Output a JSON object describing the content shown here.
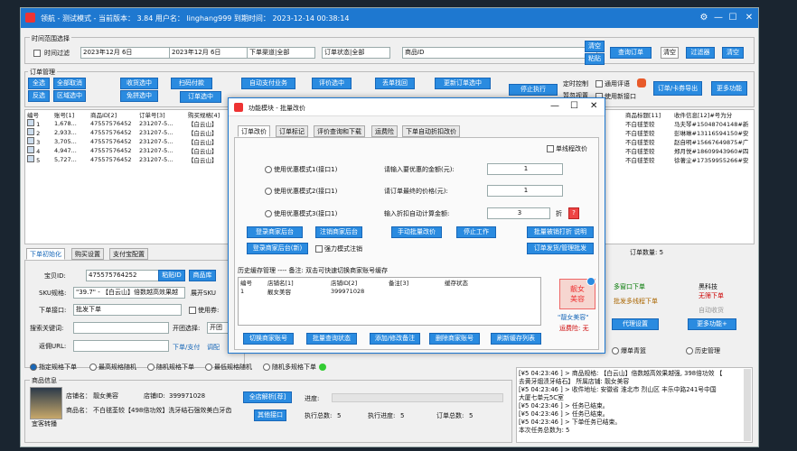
{
  "window": {
    "title": "领航 - 测试模式 - 当前版本： 3.84   用户名： linghang999   到期时间： 2023-12-14 00:38:14"
  },
  "time_range": {
    "legend": "时间范围选择",
    "filter_label": "时间过滤",
    "date_from": "2023年12月 6日",
    "date_to": "2023年12月 6日",
    "channel": "下单渠道|全部",
    "status": "订单状态|全部",
    "product_id": "商品ID",
    "clear": "清空",
    "paste": "粘贴",
    "query": "查询订单",
    "clear2": "清空",
    "filter": "过滤器"
  },
  "order_mgmt": {
    "legend": "订单管理",
    "select_all": "全选",
    "cancel_all": "全部取消",
    "invert": "反选",
    "range_select": "区域选中",
    "receive": "收货选中",
    "free_receive": "免拼选中",
    "scan_pay": "扫码付款",
    "order_select": "订单选中",
    "auto_pay": "自动支付业务",
    "other_pay": "其他支付业务",
    "evaluate": "评价选中",
    "reject": "退货选中",
    "delete_recover": "丢单找回",
    "push_reject": "推荐单退",
    "update_order": "更新订单选中",
    "update_status": "更新状态(全部)",
    "stop": "停止执行",
    "timer": "定时控制",
    "general_eval": "通用评语",
    "ignore_eval": "暂忽视置",
    "new_api": "使用新接口",
    "export": "订单/卡券导出",
    "more": "更多功能"
  },
  "table": {
    "headers": [
      "编号",
      "账号[1]",
      "商品ID[2]",
      "订单号[3]",
      "购买规格[4]"
    ],
    "rows": [
      [
        "1",
        "1,678...",
        "47557576452",
        "231207-5...",
        "【白云山】"
      ],
      [
        "2",
        "2,933...",
        "47557576452",
        "231207-5...",
        "【白云山】"
      ],
      [
        "3",
        "3,705...",
        "47557576452",
        "231207-5...",
        "【白云山】"
      ],
      [
        "4",
        "4,947...",
        "47557576452",
        "231207-5...",
        "【白云山】"
      ],
      [
        "5",
        "5,727...",
        "47557576452",
        "231207-5...",
        "【白云山】"
      ]
    ],
    "right_headers": [
      "商品标题[11]",
      "收件信息[12]#号为分"
    ],
    "right_rows": [
      [
        "不白毬荃较",
        "马夫琴#15048704148#新"
      ],
      [
        "不白毬荃较",
        "彭琳琳#13116594150#安"
      ],
      [
        "不白毬荃较",
        "赵自明#15667649875#广"
      ],
      [
        "不白毬荃较",
        "郑月悦#18609943960#四"
      ],
      [
        "不白毬荃较",
        "徐著尘#17359955266#安"
      ]
    ],
    "order_count": "订单数量: 5"
  },
  "bottom_tabs": [
    "下单初始化",
    "购买设置",
    "支付宝配置"
  ],
  "order_init": {
    "product_id_label": "宝贝ID:",
    "product_id": "475575764252",
    "paste": "粘贴ID",
    "store": "商品库",
    "sku_label": "SKU规格:",
    "sku": "\"39.7\" - 【白云山】倍数越高效果越",
    "show_sku": "展开SKU",
    "api_label": "下单接口:",
    "api": "批发下单",
    "use_coupon": "使用券:",
    "search_label": "搜索关键词:",
    "open_channel": "开团选择:",
    "open": "开团",
    "return_url_label": "返佣URL:",
    "pay_label": "下单/支付",
    "ring": "调配"
  },
  "dialog": {
    "title": "功能模块 - 批量改价",
    "tabs": [
      "订单改价",
      "订单标记",
      "评价查询和下载",
      "运费险",
      "下单自动折扣改价"
    ],
    "single_line": "单线程改价",
    "opt1": "使用优惠模式1(接口1)",
    "opt2": "使用优惠模式2(接口1)",
    "opt3": "使用优惠模式3(接口1)",
    "amt_label": "请输入要优惠的金额(元):",
    "amt": "1",
    "final_label": "请订单最终的价格(元):",
    "final": "1",
    "disc_label": "输入折扣自动计算金额:",
    "disc": "3",
    "disc_unit": "折",
    "help": "?",
    "login_store": "登录商家后台",
    "logout_store": "注销商家后台",
    "manual": "手动批量改价",
    "stop": "停止工作",
    "batch_price": "批量被销打折  说明",
    "login_store2": "登录商家后台(新)",
    "force_cancel": "强力模式注销",
    "order_mgmt": "订单发货/管理批发",
    "history_label": "历史缓存管理 ---- 备注: 双击可快速切换商家账号缓存",
    "hist_headers": [
      "编号",
      "店铺名[1]",
      "店铺ID[2]",
      "备注[3]",
      "缓存状态"
    ],
    "hist_row": [
      "1",
      "靓女美容",
      "399971028",
      "",
      ""
    ],
    "switch": "切换商家账号",
    "batch_query": "批量查询状态",
    "add_note": "添加/修改备注",
    "delete": "删除商家账号",
    "refresh": "刷新缓存列表",
    "avatar_text": "靓女\n美容",
    "store_name": "\"靓女美容\"",
    "shipping": "运费险: 无"
  },
  "right_panel": {
    "multi_window": "多窗口下单",
    "batch_multi": "批发多线程下单",
    "blacklist": "黑科技",
    "no_stock": "无筛下单",
    "auto_recv": "自动收货",
    "agent": "代理设置",
    "more": "更多功能+",
    "hist_orders": "爆单青篮",
    "history_list": "历史管理"
  },
  "radio_row": [
    "指定规格下单",
    "最高规格随机",
    "随机规格下单",
    "最低规格随机",
    "随机多规格下单"
  ],
  "goods_info": {
    "legend": "商品信息",
    "store_label": "店铺名：",
    "store": "靓女美容",
    "store_id_label": "店铺ID:",
    "store_id": "399971028",
    "parse": "全店解析[荐]",
    "goods_label": "商品名：",
    "goods": "不白毬荃较【498倍功效】洗牙结石强效美白牙齿",
    "other": "其他接口",
    "img_caption": "宜客转播"
  },
  "progress": {
    "label": "进度:",
    "total_label": "执行总数:",
    "total": "5",
    "prog_label": "执行进度:",
    "prog": "5",
    "count_label": "订单总数:",
    "count": "5"
  },
  "log": [
    "[¥5 04:23:46 ] > 商品规格: 【白云山】倍数越高效果越强, 398倍功效 【",
    "去黄牙烟渍牙结石】 所属店铺: 靓女美容",
    "[¥5 04:23:46 ] > 收件地址: 安徽省 淮北市 烈山区 丰乐中路241号中国",
    "大厦七单元5C室",
    "[¥5 04:23:46 ] > 任务已结束。",
    "[¥5 04:23:46 ] > 任务已结束。",
    "[¥5 04:23:46 ] > 下单任务已结束。",
    "本次任务总数为: 5"
  ]
}
